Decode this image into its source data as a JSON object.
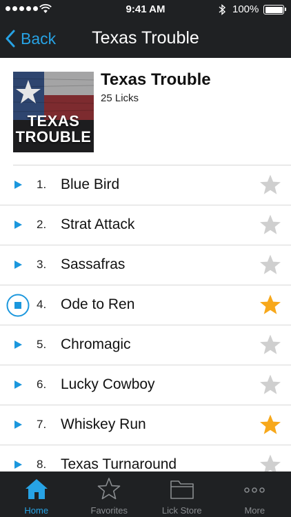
{
  "status_bar": {
    "time": "9:41 AM",
    "battery_percent": "100%",
    "battery_level": 1.0,
    "icons": [
      "signal-dots",
      "wifi-icon",
      "bluetooth-icon",
      "battery-icon"
    ]
  },
  "nav": {
    "back_label": "Back",
    "title": "Texas Trouble"
  },
  "album": {
    "title": "Texas Trouble",
    "subtitle": "25 Licks",
    "cover_text_line1": "TEXAS",
    "cover_text_line2": "TROUBLE"
  },
  "tracks": [
    {
      "number": "1.",
      "name": "Blue Bird",
      "favorite": false,
      "playing": false
    },
    {
      "number": "2.",
      "name": "Strat Attack",
      "favorite": false,
      "playing": false
    },
    {
      "number": "3.",
      "name": "Sassafras",
      "favorite": false,
      "playing": false
    },
    {
      "number": "4.",
      "name": "Ode to Ren",
      "favorite": true,
      "playing": true
    },
    {
      "number": "5.",
      "name": "Chromagic",
      "favorite": false,
      "playing": false
    },
    {
      "number": "6.",
      "name": "Lucky Cowboy",
      "favorite": false,
      "playing": false
    },
    {
      "number": "7.",
      "name": "Whiskey Run",
      "favorite": true,
      "playing": false
    },
    {
      "number": "8.",
      "name": "Texas Turnaround",
      "favorite": false,
      "playing": false
    }
  ],
  "tabs": [
    {
      "label": "Home",
      "icon": "home-icon",
      "active": true
    },
    {
      "label": "Favorites",
      "icon": "star-outline-icon",
      "active": false
    },
    {
      "label": "Lick Store",
      "icon": "folder-icon",
      "active": false
    },
    {
      "label": "More",
      "icon": "more-icon",
      "active": false
    }
  ],
  "colors": {
    "accent": "#27a3e5",
    "play": "#1b97dd",
    "favorite_on": "#f7a81b",
    "favorite_off": "#cfcfcf",
    "bar_bg": "#1f2123"
  }
}
